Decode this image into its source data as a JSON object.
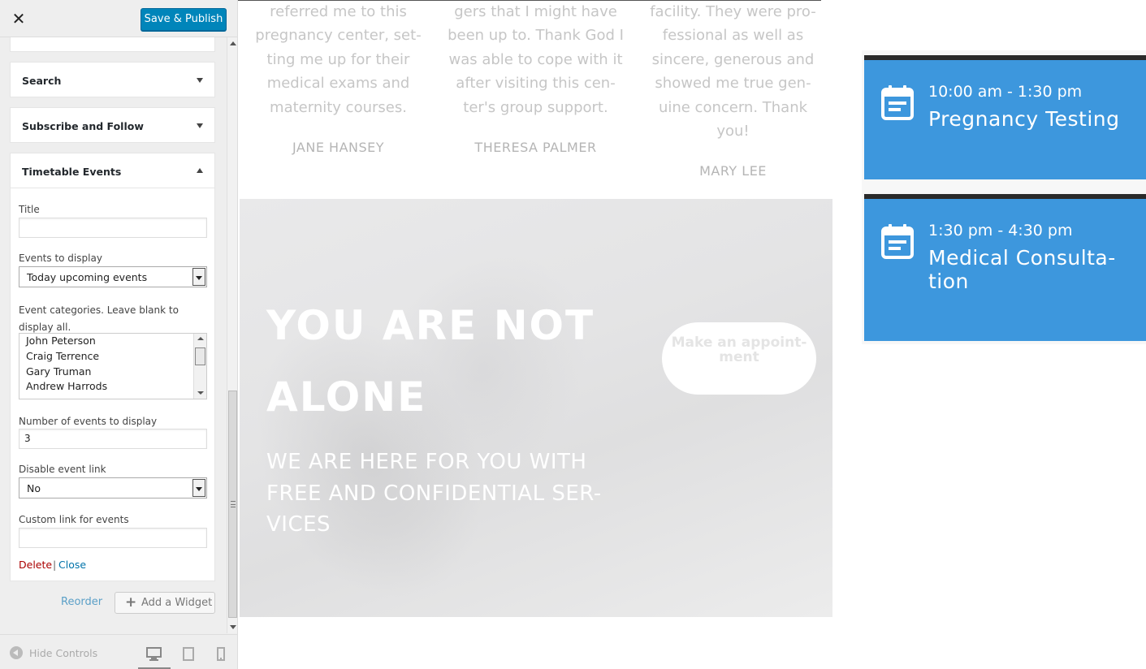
{
  "sidebar": {
    "close_label": "✕",
    "save_label": "Save & Publish",
    "collapsed_widgets": [
      {
        "title": "Search"
      },
      {
        "title": "Subscribe and Follow"
      }
    ],
    "open_widget": {
      "title": "Timetable Events",
      "fields": {
        "title_label": "Title",
        "title_value": "",
        "events_label": "Events to display",
        "events_value": "Today upcoming events",
        "categories_label": "Event categories. Leave blank to display all.",
        "categories_options": [
          "John Peterson",
          "Craig Terrence",
          "Gary Truman",
          "Andrew Harrods"
        ],
        "number_label": "Number of events to display",
        "number_value": "3",
        "disable_label": "Disable event link",
        "disable_value": "No",
        "custom_link_label": "Custom link for events",
        "custom_link_value": ""
      },
      "delete_label": "Delete",
      "separator": "|",
      "close_label": "Close"
    },
    "reorder_label": "Reorder",
    "add_widget_label": "Add a Widget",
    "footer": {
      "hide_controls_label": "Hide Controls",
      "devices": [
        "desktop-icon",
        "tablet-icon",
        "mobile-icon"
      ]
    }
  },
  "preview": {
    "testimonials": [
      {
        "text": "referred me to this pregnancy center, set-ting me up for their medical exams and maternity courses.",
        "name": "JANE HANSEY"
      },
      {
        "text": "gers that I might have been up to. Thank God I was able to cope with it after visiting this cen-ter's group support.",
        "name": "THERESA PALMER"
      },
      {
        "text": "facility. They were pro-fessional as well as sincere, generous and showed me true gen-uine concern. Thank you!",
        "name": "MARY LEE"
      }
    ],
    "hero": {
      "title": "YOU ARE NOT ALONE",
      "subtitle": "WE ARE HERE FOR YOU WITH FREE AND CONFIDENTIAL SER-VICES",
      "button_label": "Make an appoint-ment"
    },
    "events": [
      {
        "time": "10:00 am - 1:30 pm",
        "title": "Pregnancy Testing"
      },
      {
        "time": "1:30 pm - 4:30 pm",
        "title": "Medical Consulta-tion"
      }
    ],
    "colors": {
      "event_card": "#3d97dd",
      "event_border": "#2a2a2a",
      "save_button": "#0085ba",
      "delete_link": "#aa0000",
      "close_link": "#0073aa"
    }
  }
}
